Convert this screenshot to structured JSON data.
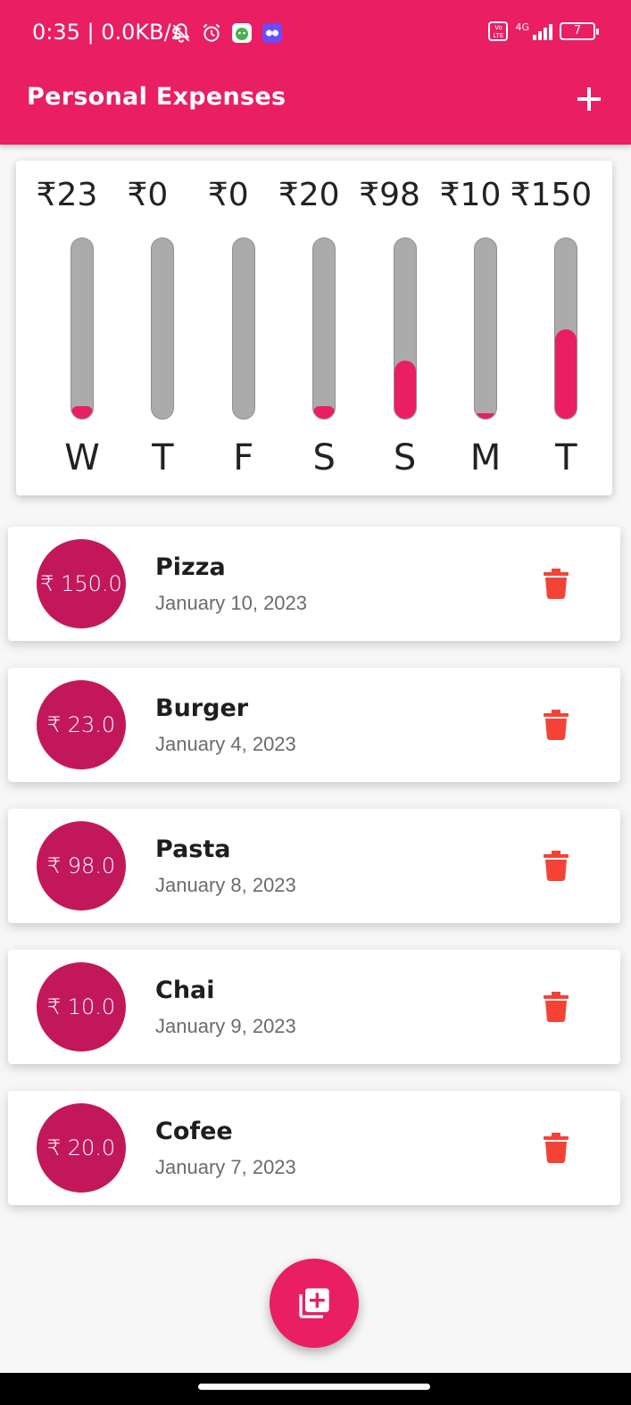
{
  "status_bar": {
    "time": "0:35",
    "network_speed": "0.0KB/s",
    "network_type": "4G",
    "volte_label": "Vo LTE",
    "battery": "7",
    "icons": [
      "muted-bell-icon",
      "alarm-icon",
      "app-notification-icon",
      "app-notification-icon-2"
    ]
  },
  "app_bar": {
    "title": "Personal Expenses",
    "add_icon": "plus-icon"
  },
  "chart": {
    "bars": [
      {
        "amount": "₹23",
        "day": "W",
        "fill": 0.07
      },
      {
        "amount": "₹0",
        "day": "T",
        "fill": 0.0
      },
      {
        "amount": "₹0",
        "day": "F",
        "fill": 0.0
      },
      {
        "amount": "₹20",
        "day": "S",
        "fill": 0.07
      },
      {
        "amount": "₹98",
        "day": "S",
        "fill": 0.32
      },
      {
        "amount": "₹10",
        "day": "M",
        "fill": 0.03
      },
      {
        "amount": "₹150",
        "day": "T",
        "fill": 0.49
      }
    ],
    "fill_color": "#e91e63",
    "track_color": "#ababab"
  },
  "transactions": [
    {
      "amount": "₹ 150.0",
      "title": "Pizza",
      "date": "January 10, 2023"
    },
    {
      "amount": "₹ 23.0",
      "title": "Burger",
      "date": "January 4, 2023"
    },
    {
      "amount": "₹ 98.0",
      "title": "Pasta",
      "date": "January 8, 2023"
    },
    {
      "amount": "₹ 10.0",
      "title": "Chai",
      "date": "January 9, 2023"
    },
    {
      "amount": "₹ 20.0",
      "title": "Cofee",
      "date": "January 7, 2023"
    }
  ],
  "fab": {
    "icon": "add-library-icon"
  },
  "colors": {
    "primary": "#e91e63",
    "avatar": "#c2185b",
    "delete": "#f44336"
  }
}
